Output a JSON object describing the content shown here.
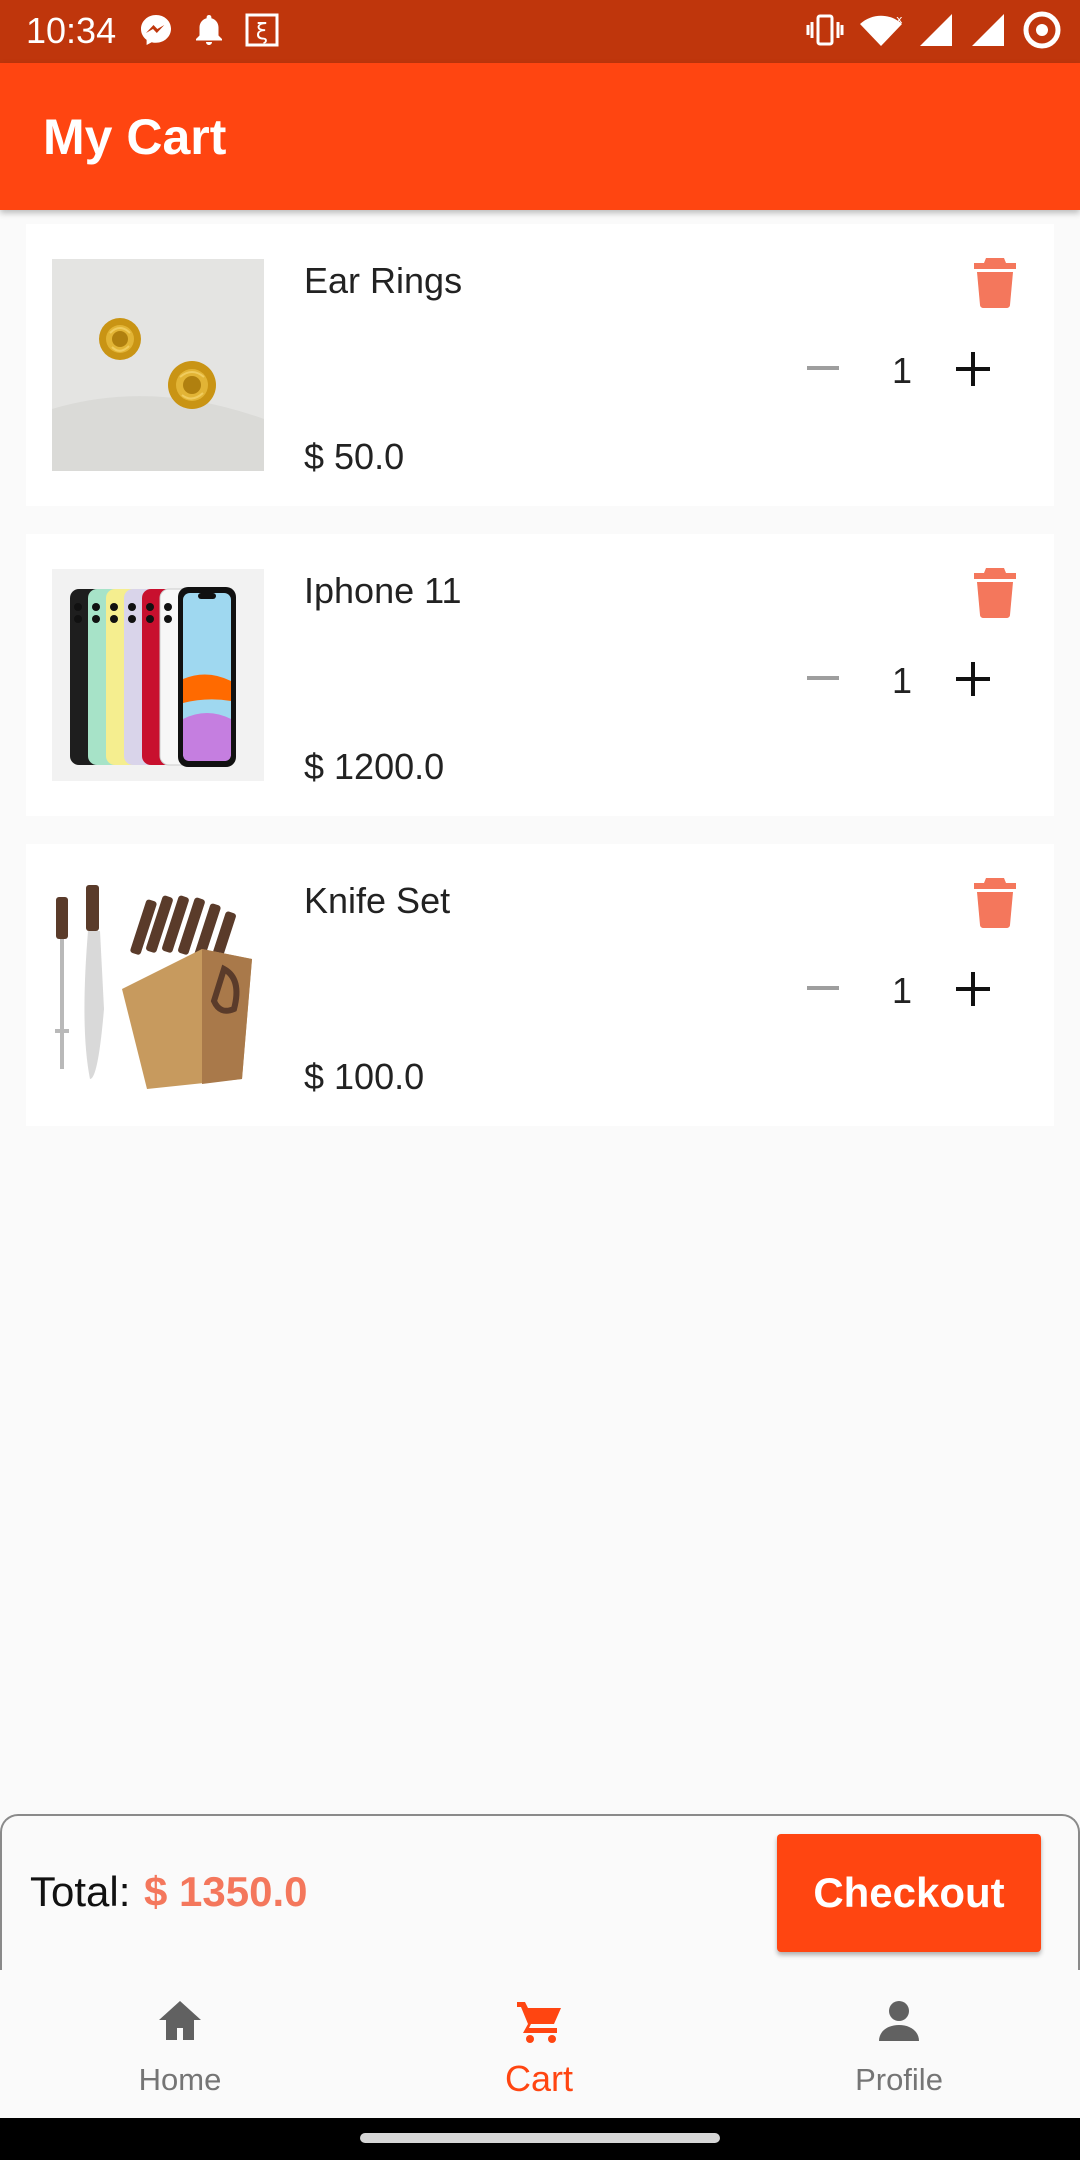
{
  "status_bar": {
    "time": "10:34",
    "left_icons": [
      "messenger-icon",
      "bell-icon",
      "rupee-icon"
    ],
    "right_icons": [
      "vibrate-icon",
      "wifi-icon",
      "signal-icon",
      "signal-icon",
      "circle-icon"
    ]
  },
  "app_bar": {
    "title": "My Cart"
  },
  "cart": {
    "items": [
      {
        "name": "Ear Rings",
        "price": "$ 50.0",
        "quantity": "1",
        "image": "gold-rose-earrings-image"
      },
      {
        "name": "Iphone 11",
        "price": "$ 1200.0",
        "quantity": "1",
        "image": "iphone-11-colors-image"
      },
      {
        "name": "Knife Set",
        "price": "$ 100.0",
        "quantity": "1",
        "image": "knife-block-set-image"
      }
    ],
    "delete_icon": "trash-icon",
    "minus_icon": "minus-icon",
    "plus_icon": "plus-icon"
  },
  "checkout": {
    "total_label": "Total:",
    "total_amount": "$ 1350.0",
    "button_label": "Checkout"
  },
  "bottom_nav": {
    "items": [
      {
        "label": "Home",
        "icon": "home-icon",
        "active": false
      },
      {
        "label": "Cart",
        "icon": "cart-icon",
        "active": true
      },
      {
        "label": "Profile",
        "icon": "person-icon",
        "active": false
      }
    ]
  },
  "colors": {
    "primary": "#ff4511",
    "status_bar": "#bf360c",
    "accent_price": "#f4775c",
    "delete_icon": "#f4775c",
    "inactive_nav": "#757575"
  }
}
